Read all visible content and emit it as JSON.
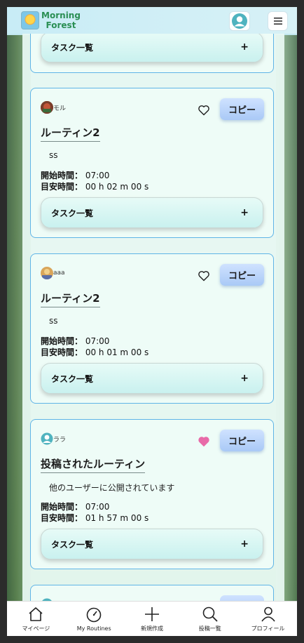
{
  "header": {
    "logo_line1": "Morning",
    "logo_line2": "Forest"
  },
  "colors": {
    "accent": "#5fb4e6",
    "brand_green": "#2a8f54",
    "copy_button": "#b8d4fa",
    "liked_heart": "#e86aa8"
  },
  "cards": [
    {
      "task_list_label": "タスク一覧",
      "task_plus": "+"
    },
    {
      "user_name": "モル",
      "liked": false,
      "copy_label": "コピー",
      "title": "ルーティン2",
      "description": "ss",
      "start_label": "開始時間：",
      "start_value": "07:00",
      "duration_label": "目安時間：",
      "duration_value": "00 h 02 m 00 s",
      "task_list_label": "タスク一覧",
      "task_plus": "+"
    },
    {
      "user_name": "aaa",
      "liked": false,
      "copy_label": "コピー",
      "title": "ルーティン2",
      "description": "ss",
      "start_label": "開始時間：",
      "start_value": "07:00",
      "duration_label": "目安時間：",
      "duration_value": "00 h 01 m 00 s",
      "task_list_label": "タスク一覧",
      "task_plus": "+"
    },
    {
      "user_name": "ララ",
      "liked": true,
      "copy_label": "コピー",
      "title": "投稿されたルーティン",
      "description": "他のユーザーに公開されています",
      "start_label": "開始時間：",
      "start_value": "07:00",
      "duration_label": "目安時間：",
      "duration_value": "01 h 57 m 00 s",
      "task_list_label": "タスク一覧",
      "task_plus": "+"
    }
  ],
  "bottom_nav": [
    {
      "label": "マイページ",
      "icon": "home-icon"
    },
    {
      "label": "My Routines",
      "icon": "clock-icon"
    },
    {
      "label": "新規作成",
      "icon": "plus-icon"
    },
    {
      "label": "投稿一覧",
      "icon": "search-icon"
    },
    {
      "label": "プロフィール",
      "icon": "person-icon"
    }
  ]
}
